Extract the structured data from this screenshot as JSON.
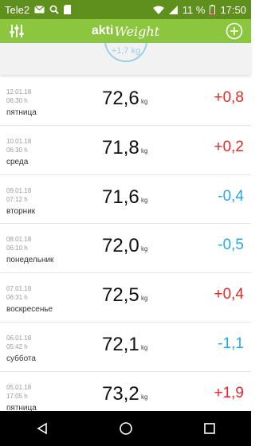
{
  "status_bar": {
    "carrier": "Tele2",
    "battery_percent": "11 %",
    "time": "17:50",
    "icons": [
      "mail-icon",
      "search-icon",
      "sd-card-icon",
      "wifi-icon",
      "signal-icon",
      "battery-icon"
    ]
  },
  "app_bar": {
    "logo_part1": "akti",
    "logo_part2": "Weight",
    "left_icon": "sliders-icon",
    "right_icon": "add-circle-icon",
    "color": "#8cc63f"
  },
  "summary": {
    "circle_value": "+1,7 kg"
  },
  "colors": {
    "positive": "#e8262a",
    "negative": "#29a8e0"
  },
  "entries": [
    {
      "date": "12.01.18",
      "time": "06:30 h",
      "day": "пятница",
      "weight": "72,6",
      "unit": "kg",
      "diff": "+0,8",
      "sign": "positive"
    },
    {
      "date": "10.01.18",
      "time": "06:30 h",
      "day": "среда",
      "weight": "71,8",
      "unit": "kg",
      "diff": "+0,2",
      "sign": "positive"
    },
    {
      "date": "09.01.18",
      "time": "07:12 h",
      "day": "вторник",
      "weight": "71,6",
      "unit": "kg",
      "diff": "-0,4",
      "sign": "negative"
    },
    {
      "date": "08.01.18",
      "time": "06:10 h",
      "day": "понедельник",
      "weight": "72,0",
      "unit": "kg",
      "diff": "-0,5",
      "sign": "negative"
    },
    {
      "date": "07.01.18",
      "time": "06:31 h",
      "day": "воскресенье",
      "weight": "72,5",
      "unit": "kg",
      "diff": "+0,4",
      "sign": "positive"
    },
    {
      "date": "06.01.18",
      "time": "05:42 h",
      "day": "суббота",
      "weight": "72,1",
      "unit": "kg",
      "diff": "-1,1",
      "sign": "negative"
    },
    {
      "date": "05.01.18",
      "time": "17:05 h",
      "day": "пятница",
      "weight": "73,2",
      "unit": "kg",
      "diff": "+1,9",
      "sign": "positive"
    }
  ],
  "nav_bar": {
    "buttons": [
      "back-icon",
      "home-icon",
      "recents-icon"
    ]
  }
}
